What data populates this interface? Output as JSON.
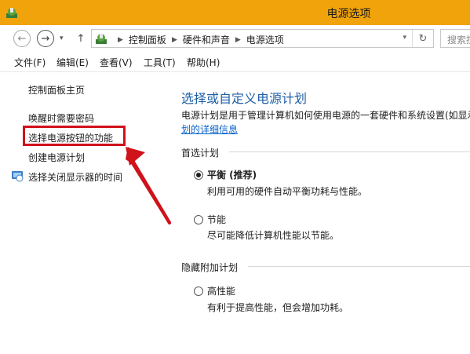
{
  "window": {
    "title": "电源选项",
    "accent": "#f0a30a"
  },
  "nav": {
    "back_icon": "back-arrow-icon",
    "forward_icon": "forward-arrow-icon",
    "up_icon": "up-arrow-icon",
    "breadcrumbs": [
      "控制面板",
      "硬件和声音",
      "电源选项"
    ],
    "search_placeholder": "搜索控"
  },
  "menu": [
    "文件(F)",
    "编辑(E)",
    "查看(V)",
    "工具(T)",
    "帮助(H)"
  ],
  "sidebar": {
    "home": "控制面板主页",
    "items": [
      "唤醒时需要密码",
      "选择电源按钮的功能",
      "创建电源计划",
      "选择关闭显示器的时间"
    ]
  },
  "main": {
    "title": "选择或自定义电源计划",
    "description": "电源计划是用于管理计算机如何使用电源的一套硬件和系统设置(如显示",
    "link": "划的详细信息",
    "preferred_section": "首选计划",
    "hidden_section": "隐藏附加计划",
    "plans": [
      {
        "name": "平衡 (推荐)",
        "desc": "利用可用的硬件自动平衡功耗与性能。",
        "selected": true
      },
      {
        "name": "节能",
        "desc": "尽可能降低计算机性能以节能。",
        "selected": false
      },
      {
        "name": "高性能",
        "desc": "有利于提高性能，但会增加功耗。",
        "selected": false
      }
    ]
  },
  "annotation": {
    "color": "#d0121b"
  }
}
